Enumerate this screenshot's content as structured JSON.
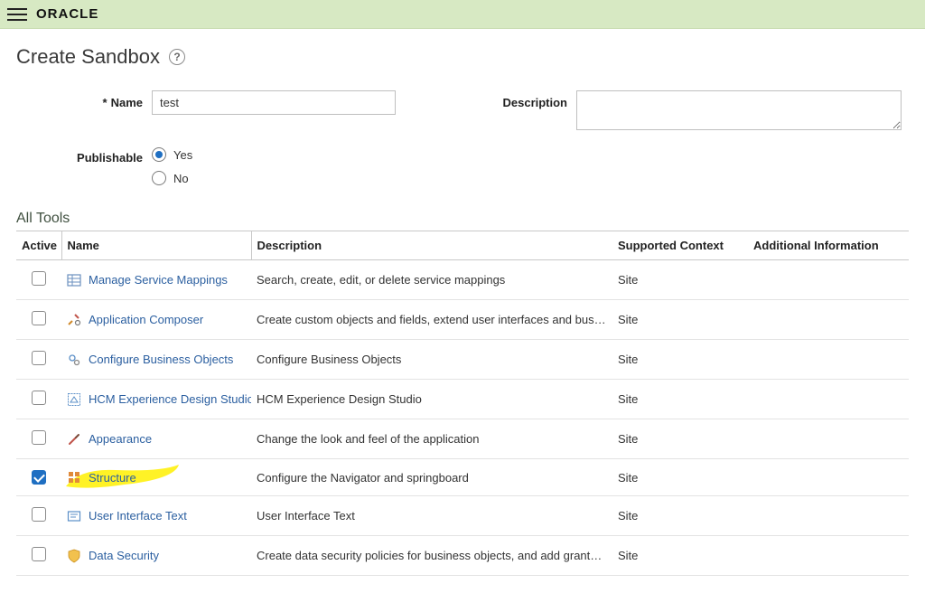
{
  "brand": "ORACLE",
  "page_title": "Create Sandbox",
  "form": {
    "name_label": "Name",
    "name_value": "test",
    "publishable_label": "Publishable",
    "publishable_options": {
      "yes": "Yes",
      "no": "No"
    },
    "publishable_selected": "yes",
    "description_label": "Description",
    "description_value": ""
  },
  "section_title": "All Tools",
  "table": {
    "headers": {
      "active": "Active",
      "name": "Name",
      "description": "Description",
      "context": "Supported Context",
      "additional": "Additional Information"
    },
    "rows": [
      {
        "checked": false,
        "name": "Manage Service Mappings",
        "icon": "mappings",
        "description": "Search, create, edit, or delete service mappings",
        "context": "Site",
        "additional": ""
      },
      {
        "checked": false,
        "name": "Application Composer",
        "icon": "composer",
        "description": "Create custom objects and fields, extend user interfaces and business lo…",
        "context": "Site",
        "additional": ""
      },
      {
        "checked": false,
        "name": "Configure Business Objects",
        "icon": "gears",
        "description": "Configure Business Objects",
        "context": "Site",
        "additional": ""
      },
      {
        "checked": false,
        "name": "HCM Experience Design Studio",
        "icon": "design",
        "description": "HCM Experience Design Studio",
        "context": "Site",
        "additional": ""
      },
      {
        "checked": false,
        "name": "Appearance",
        "icon": "brush",
        "description": "Change the look and feel of the application",
        "context": "Site",
        "additional": ""
      },
      {
        "checked": true,
        "name": "Structure",
        "icon": "grid",
        "highlight": true,
        "description": "Configure the Navigator and springboard",
        "context": "Site",
        "additional": ""
      },
      {
        "checked": false,
        "name": "User Interface Text",
        "icon": "uitext",
        "description": "User Interface Text",
        "context": "Site",
        "additional": ""
      },
      {
        "checked": false,
        "name": "Data Security",
        "icon": "shield",
        "description": "Create data security policies for business objects, and add grants to the …",
        "context": "Site",
        "additional": ""
      }
    ]
  }
}
